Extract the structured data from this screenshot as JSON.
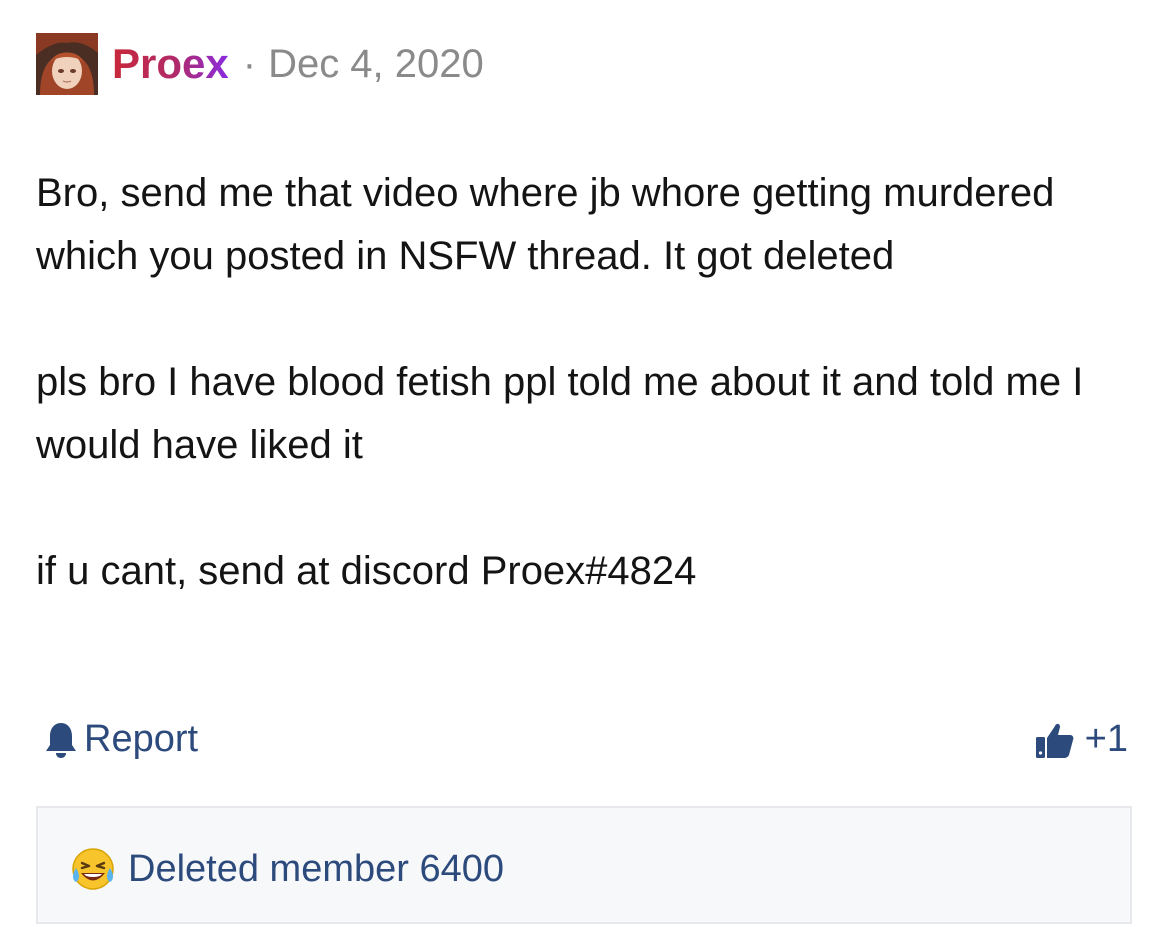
{
  "post": {
    "author": "Proex",
    "separator": "·",
    "date": "Dec 4, 2020",
    "paragraphs": [
      "Bro, send me that video where jb whore getting murdered which you posted in NSFW thread. It got deleted",
      "pls bro I have blood fetish ppl told me about it and told me I would have liked it",
      "if u cant, send at discord Proex#4824"
    ]
  },
  "actions": {
    "report_label": "Report",
    "report_icon": "bell-icon",
    "like_icon": "thumbs-up-icon",
    "like_count": "+1"
  },
  "reactions": {
    "emoji": "laughing-crying-emoji",
    "users": [
      "Deleted member 6400"
    ]
  },
  "colors": {
    "username_gradient": [
      "#c8283a",
      "#8a2be2"
    ],
    "link": "#2c4a7c",
    "meta": "#8a8a8a",
    "reaction_bg": "#f7f8fa"
  }
}
